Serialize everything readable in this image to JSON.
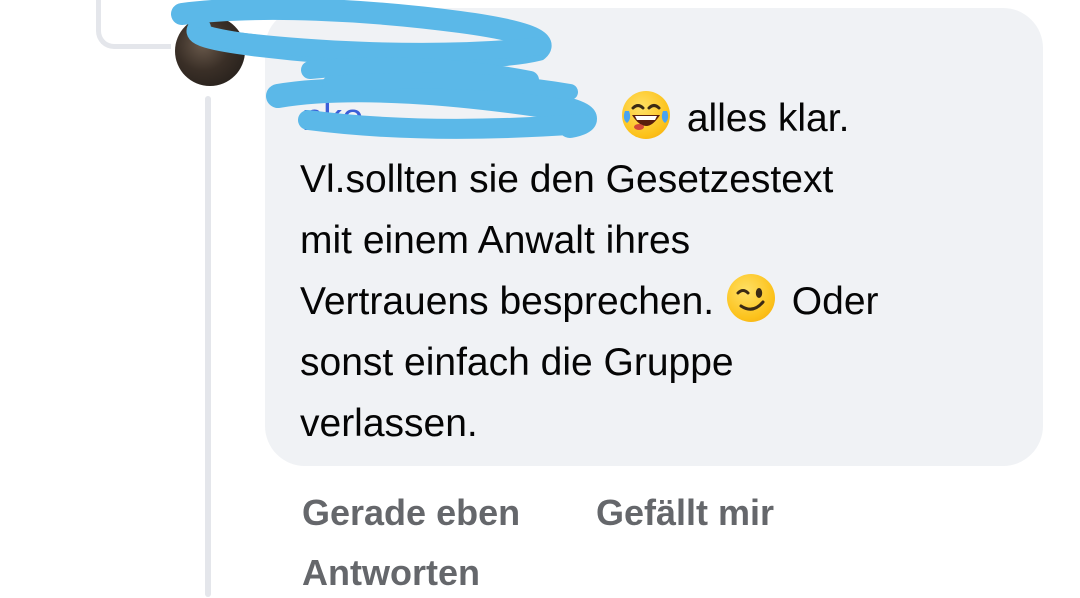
{
  "comment": {
    "author_name": "",
    "mention": "nko",
    "lines": [
      "alles klar.",
      "Vl.sollten sie den Gesetzestext",
      "mit einem Anwalt ihres",
      "Vertrauens besprechen.",
      "Oder",
      "sonst einfach die Gruppe",
      "verlassen."
    ],
    "emojis": [
      "laughing-tears-emoji",
      "winking-face-emoji"
    ]
  },
  "actions": {
    "timestamp": "Gerade eben",
    "like_label": "Gefällt mir",
    "reply_label": "Antworten"
  },
  "colors": {
    "bubble": "#f0f2f5",
    "mention": "#3b5fd8",
    "meta_text": "#65676b",
    "redaction": "#5bb8e8"
  }
}
